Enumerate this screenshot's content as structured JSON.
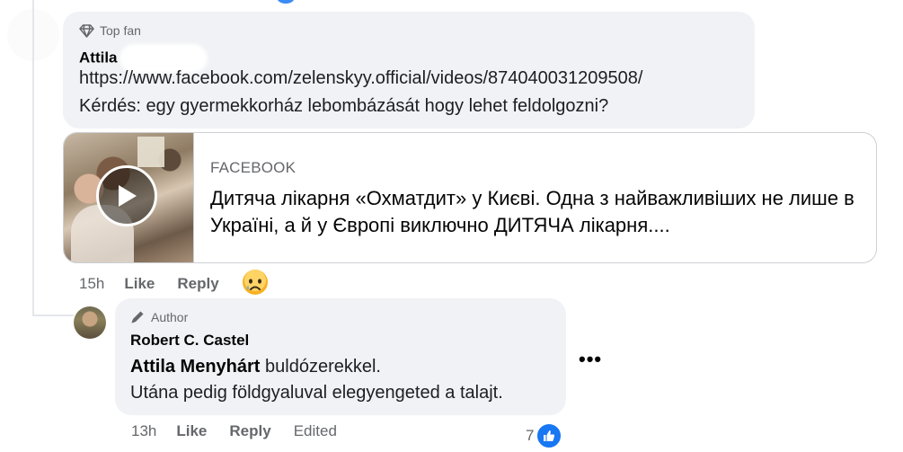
{
  "comment1": {
    "badge": "Top fan",
    "author": "Attila",
    "line1": "https://www.facebook.com/zelenskyy.official/videos/874040031209508/",
    "line2": "Kérdés: egy gyermekkorház lebombázását hogy lehet feldolgozni?",
    "preview": {
      "source": "FACEBOOK",
      "title": "Дитяча лікарня «Охматдит» у Києві. Одна з найважливіших не лише в Україні, а й у Європі виключно ДИТЯЧА лікарня...."
    },
    "actions": {
      "time": "15h",
      "like": "Like",
      "reply": "Reply"
    }
  },
  "comment2": {
    "badge": "Author",
    "author": "Robert C. Castel",
    "mention": "Attila Menyhárt",
    "text1_rest": " buldózerekkel.",
    "text2": "Utána pedig földgyaluval elegyengeted a talajt.",
    "more": "•••",
    "actions": {
      "time": "13h",
      "like": "Like",
      "reply": "Reply",
      "edited": "Edited"
    },
    "reaction_count": "7"
  },
  "colors": {
    "bubble": "#f0f2f5",
    "meta": "#65676b",
    "accent": "#1877f2"
  },
  "icons": [
    "diamond-icon",
    "pencil-icon",
    "play-icon",
    "sad-reaction-icon",
    "like-reaction-icon",
    "more-options-icon"
  ]
}
